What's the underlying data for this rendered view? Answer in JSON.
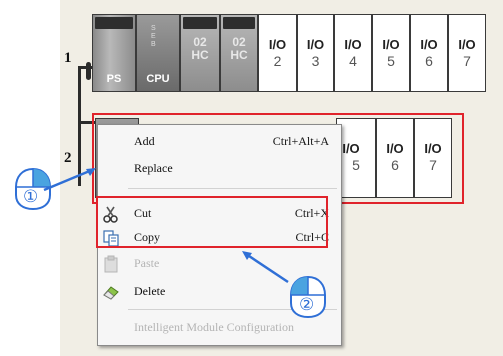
{
  "rack": {
    "row1_label": "1",
    "row2_label": "2",
    "row1_slots": [
      {
        "name": "ps-module",
        "label": "PS"
      },
      {
        "name": "cpu-module",
        "label": "CPU",
        "leds": [
          "S",
          "E",
          "B"
        ]
      },
      {
        "name": "hc-module-1",
        "line1": "02",
        "line2": "HC"
      },
      {
        "name": "hc-module-2",
        "line1": "02",
        "line2": "HC"
      },
      {
        "name": "io-slot-2",
        "line1": "I/O",
        "line2": "2"
      },
      {
        "name": "io-slot-3",
        "line1": "I/O",
        "line2": "3"
      },
      {
        "name": "io-slot-4",
        "line1": "I/O",
        "line2": "4"
      },
      {
        "name": "io-slot-5",
        "line1": "I/O",
        "line2": "5"
      },
      {
        "name": "io-slot-6",
        "line1": "I/O",
        "line2": "6"
      },
      {
        "name": "io-slot-7",
        "line1": "I/O",
        "line2": "7"
      }
    ],
    "row2_slots": [
      {
        "name": "row2-io-slot-5",
        "line1": "I/O",
        "line2": "5"
      },
      {
        "name": "row2-io-slot-6",
        "line1": "I/O",
        "line2": "6"
      },
      {
        "name": "row2-io-slot-7",
        "line1": "I/O",
        "line2": "7"
      }
    ]
  },
  "context_menu": {
    "items": [
      {
        "label": "Add",
        "shortcut": "Ctrl+Alt+A",
        "icon": "none",
        "enabled": true
      },
      {
        "label": "Replace",
        "shortcut": "",
        "icon": "none",
        "enabled": true
      },
      {
        "label": "Cut",
        "shortcut": "Ctrl+X",
        "icon": "scissors-icon",
        "enabled": true
      },
      {
        "label": "Copy",
        "shortcut": "Ctrl+C",
        "icon": "copy-icon",
        "enabled": true
      },
      {
        "label": "Paste",
        "shortcut": "",
        "icon": "paste-icon",
        "enabled": false
      },
      {
        "label": "Delete",
        "shortcut": "",
        "icon": "eraser-icon",
        "enabled": true
      },
      {
        "label": "Intelligent Module Configuration",
        "shortcut": "",
        "icon": "none",
        "enabled": false
      }
    ]
  },
  "markers": {
    "mouse_right_click": "①",
    "mouse_left_click": "②"
  },
  "colors": {
    "highlight": "#e0232b",
    "arrow": "#2f6fd6",
    "marker_fill": "#4aa3e0"
  }
}
